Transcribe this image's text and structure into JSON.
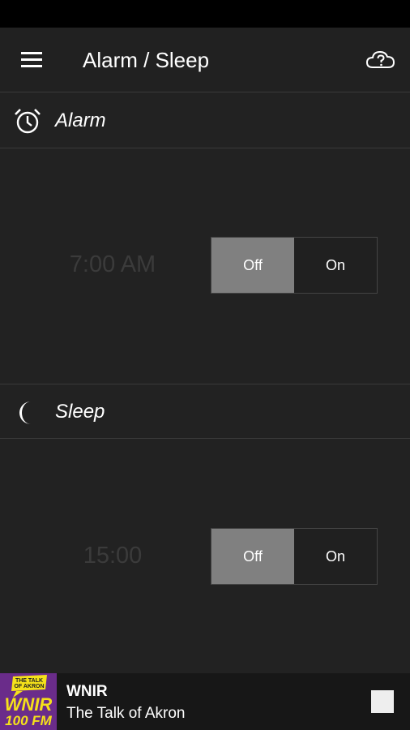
{
  "app_bar": {
    "title": "Alarm / Sleep",
    "menu_icon": "hamburger-menu-icon",
    "help_icon": "cloud-question-icon"
  },
  "alarm": {
    "label": "Alarm",
    "icon": "alarm-clock-icon",
    "time": "7:00 AM",
    "toggle": {
      "off_label": "Off",
      "on_label": "On",
      "selected": "Off"
    }
  },
  "sleep": {
    "label": "Sleep",
    "icon": "crescent-moon-icon",
    "time": "15:00",
    "toggle": {
      "off_label": "Off",
      "on_label": "On",
      "selected": "Off"
    }
  },
  "player": {
    "station_name": "WNIR",
    "station_desc": "The Talk of Akron",
    "logo_text_top": "THE TALK OF AKRON",
    "logo_text_main": "WNIR",
    "logo_text_sub": "100 FM",
    "stop_icon": "stop-icon"
  },
  "colors": {
    "background": "#222222",
    "toggle_active": "#808080",
    "logo_bg": "#6a2c8a",
    "logo_yellow": "#f5e11a"
  }
}
